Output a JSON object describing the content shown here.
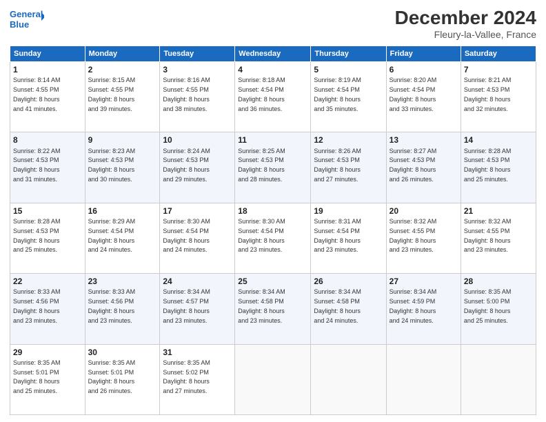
{
  "header": {
    "logo_line1": "General",
    "logo_line2": "Blue",
    "month": "December 2024",
    "location": "Fleury-la-Vallee, France"
  },
  "weekdays": [
    "Sunday",
    "Monday",
    "Tuesday",
    "Wednesday",
    "Thursday",
    "Friday",
    "Saturday"
  ],
  "weeks": [
    [
      {
        "day": "1",
        "info": "Sunrise: 8:14 AM\nSunset: 4:55 PM\nDaylight: 8 hours\nand 41 minutes."
      },
      {
        "day": "2",
        "info": "Sunrise: 8:15 AM\nSunset: 4:55 PM\nDaylight: 8 hours\nand 39 minutes."
      },
      {
        "day": "3",
        "info": "Sunrise: 8:16 AM\nSunset: 4:55 PM\nDaylight: 8 hours\nand 38 minutes."
      },
      {
        "day": "4",
        "info": "Sunrise: 8:18 AM\nSunset: 4:54 PM\nDaylight: 8 hours\nand 36 minutes."
      },
      {
        "day": "5",
        "info": "Sunrise: 8:19 AM\nSunset: 4:54 PM\nDaylight: 8 hours\nand 35 minutes."
      },
      {
        "day": "6",
        "info": "Sunrise: 8:20 AM\nSunset: 4:54 PM\nDaylight: 8 hours\nand 33 minutes."
      },
      {
        "day": "7",
        "info": "Sunrise: 8:21 AM\nSunset: 4:53 PM\nDaylight: 8 hours\nand 32 minutes."
      }
    ],
    [
      {
        "day": "8",
        "info": "Sunrise: 8:22 AM\nSunset: 4:53 PM\nDaylight: 8 hours\nand 31 minutes."
      },
      {
        "day": "9",
        "info": "Sunrise: 8:23 AM\nSunset: 4:53 PM\nDaylight: 8 hours\nand 30 minutes."
      },
      {
        "day": "10",
        "info": "Sunrise: 8:24 AM\nSunset: 4:53 PM\nDaylight: 8 hours\nand 29 minutes."
      },
      {
        "day": "11",
        "info": "Sunrise: 8:25 AM\nSunset: 4:53 PM\nDaylight: 8 hours\nand 28 minutes."
      },
      {
        "day": "12",
        "info": "Sunrise: 8:26 AM\nSunset: 4:53 PM\nDaylight: 8 hours\nand 27 minutes."
      },
      {
        "day": "13",
        "info": "Sunrise: 8:27 AM\nSunset: 4:53 PM\nDaylight: 8 hours\nand 26 minutes."
      },
      {
        "day": "14",
        "info": "Sunrise: 8:28 AM\nSunset: 4:53 PM\nDaylight: 8 hours\nand 25 minutes."
      }
    ],
    [
      {
        "day": "15",
        "info": "Sunrise: 8:28 AM\nSunset: 4:53 PM\nDaylight: 8 hours\nand 25 minutes."
      },
      {
        "day": "16",
        "info": "Sunrise: 8:29 AM\nSunset: 4:54 PM\nDaylight: 8 hours\nand 24 minutes."
      },
      {
        "day": "17",
        "info": "Sunrise: 8:30 AM\nSunset: 4:54 PM\nDaylight: 8 hours\nand 24 minutes."
      },
      {
        "day": "18",
        "info": "Sunrise: 8:30 AM\nSunset: 4:54 PM\nDaylight: 8 hours\nand 23 minutes."
      },
      {
        "day": "19",
        "info": "Sunrise: 8:31 AM\nSunset: 4:54 PM\nDaylight: 8 hours\nand 23 minutes."
      },
      {
        "day": "20",
        "info": "Sunrise: 8:32 AM\nSunset: 4:55 PM\nDaylight: 8 hours\nand 23 minutes."
      },
      {
        "day": "21",
        "info": "Sunrise: 8:32 AM\nSunset: 4:55 PM\nDaylight: 8 hours\nand 23 minutes."
      }
    ],
    [
      {
        "day": "22",
        "info": "Sunrise: 8:33 AM\nSunset: 4:56 PM\nDaylight: 8 hours\nand 23 minutes."
      },
      {
        "day": "23",
        "info": "Sunrise: 8:33 AM\nSunset: 4:56 PM\nDaylight: 8 hours\nand 23 minutes."
      },
      {
        "day": "24",
        "info": "Sunrise: 8:34 AM\nSunset: 4:57 PM\nDaylight: 8 hours\nand 23 minutes."
      },
      {
        "day": "25",
        "info": "Sunrise: 8:34 AM\nSunset: 4:58 PM\nDaylight: 8 hours\nand 23 minutes."
      },
      {
        "day": "26",
        "info": "Sunrise: 8:34 AM\nSunset: 4:58 PM\nDaylight: 8 hours\nand 24 minutes."
      },
      {
        "day": "27",
        "info": "Sunrise: 8:34 AM\nSunset: 4:59 PM\nDaylight: 8 hours\nand 24 minutes."
      },
      {
        "day": "28",
        "info": "Sunrise: 8:35 AM\nSunset: 5:00 PM\nDaylight: 8 hours\nand 25 minutes."
      }
    ],
    [
      {
        "day": "29",
        "info": "Sunrise: 8:35 AM\nSunset: 5:01 PM\nDaylight: 8 hours\nand 25 minutes."
      },
      {
        "day": "30",
        "info": "Sunrise: 8:35 AM\nSunset: 5:01 PM\nDaylight: 8 hours\nand 26 minutes."
      },
      {
        "day": "31",
        "info": "Sunrise: 8:35 AM\nSunset: 5:02 PM\nDaylight: 8 hours\nand 27 minutes."
      },
      null,
      null,
      null,
      null
    ]
  ]
}
